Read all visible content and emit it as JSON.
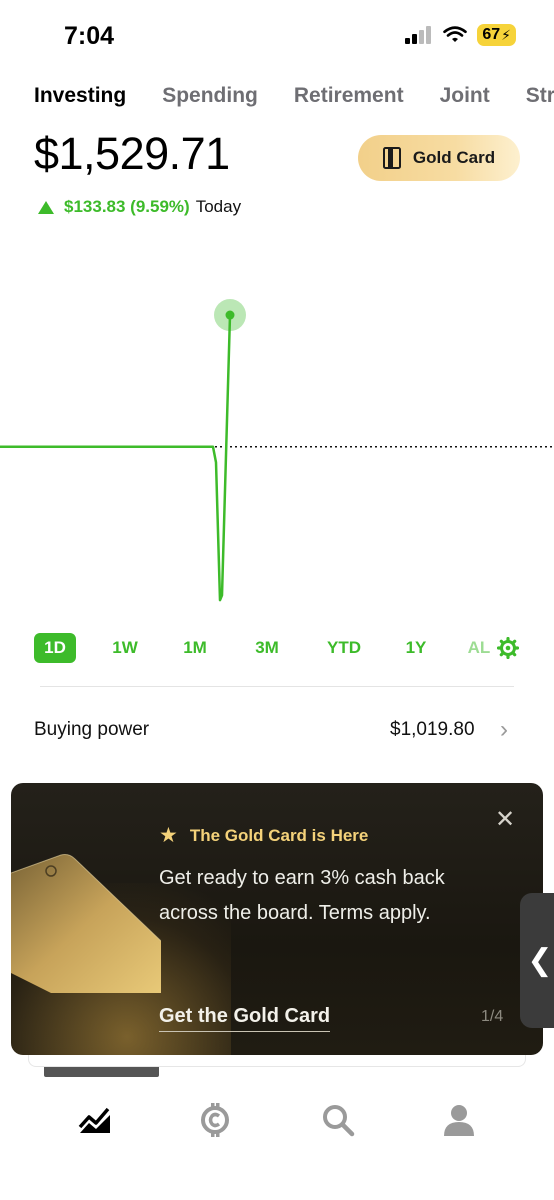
{
  "status_bar": {
    "time": "7:04",
    "battery": "67"
  },
  "tabs": [
    {
      "label": "Investing",
      "active": true
    },
    {
      "label": "Spending",
      "active": false
    },
    {
      "label": "Retirement",
      "active": false
    },
    {
      "label": "Joint",
      "active": false
    },
    {
      "label": "Stra",
      "active": false
    }
  ],
  "portfolio": {
    "balance": "$1,529.71",
    "change": "$133.83 (9.59%)",
    "change_period": "Today",
    "gold_button": "Gold Card"
  },
  "chart_data": {
    "type": "line",
    "title": "",
    "xlabel": "",
    "ylabel": "",
    "series": [
      {
        "values": [
          1395.88,
          1395.88,
          1395.88,
          1395.88,
          1395.88,
          1395.88,
          1395.88,
          1380.0,
          1240.0,
          1245.0,
          1529.71
        ]
      }
    ],
    "baseline": 1395.88,
    "colors": {
      "line": "#3dbb2a",
      "baseline": "#111111",
      "dot": "#3dbb2a"
    }
  },
  "ranges": [
    {
      "label": "1D",
      "active": true
    },
    {
      "label": "1W",
      "active": false
    },
    {
      "label": "1M",
      "active": false
    },
    {
      "label": "3M",
      "active": false
    },
    {
      "label": "YTD",
      "active": false
    },
    {
      "label": "1Y",
      "active": false
    },
    {
      "label": "AL",
      "active": false
    }
  ],
  "buying_power": {
    "label": "Buying power",
    "value": "$1,019.80"
  },
  "promo": {
    "title": "The Gold Card is Here",
    "body": "Get ready to earn 3% cash back across the board. Terms apply.",
    "cta": "Get the Gold Card",
    "page": "1/4"
  },
  "nav": [
    "investing-icon",
    "crypto-icon",
    "search-icon",
    "account-icon"
  ],
  "colors": {
    "accent": "#3dbb2a",
    "gold": "#f4d27a"
  }
}
